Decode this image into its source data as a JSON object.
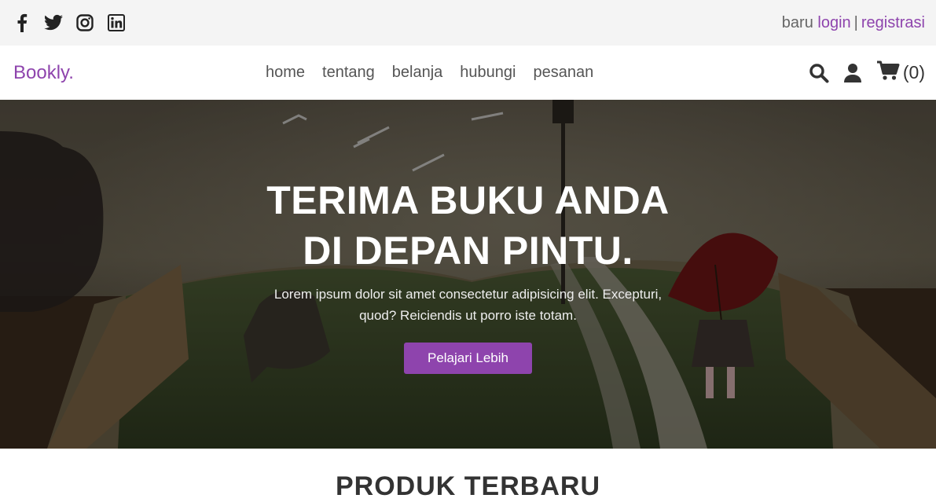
{
  "topbar": {
    "social": [
      {
        "name": "facebook-icon"
      },
      {
        "name": "twitter-icon"
      },
      {
        "name": "instagram-icon"
      },
      {
        "name": "linkedin-icon"
      }
    ],
    "auth_prefix": "baru",
    "login": "login",
    "separator": "|",
    "register": "registrasi"
  },
  "navbar": {
    "logo": "Bookly.",
    "links": [
      "home",
      "tentang",
      "belanja",
      "hubungi",
      "pesanan"
    ],
    "cart_count": "(0)"
  },
  "hero": {
    "title_line1": "TERIMA BUKU ANDA",
    "title_line2": "DI DEPAN PINTU.",
    "desc_line1": "Lorem ipsum dolor sit amet consectetur adipisicing elit. Excepturi,",
    "desc_line2": "quod? Reiciendis ut porro iste totam.",
    "button": "Pelajari Lebih"
  },
  "section": {
    "title": "PRODUK TERBARU"
  },
  "colors": {
    "accent": "#8e44ad",
    "topbar_bg": "#f4f4f4"
  }
}
